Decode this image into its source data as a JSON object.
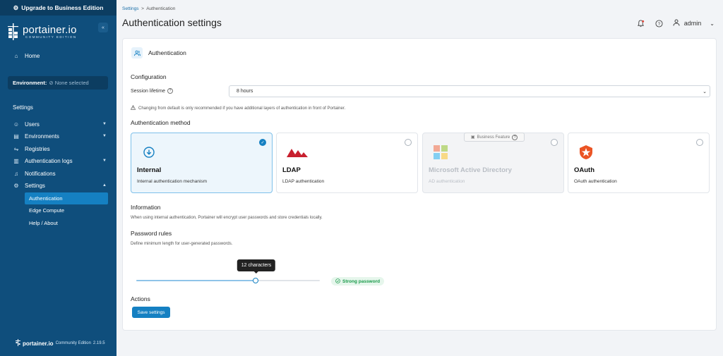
{
  "sidebar": {
    "upgrade_label": "Upgrade to Business Edition",
    "logo_name": "portainer.io",
    "logo_sub": "COMMUNITY EDITION",
    "home": "Home",
    "environment_label": "Environment:",
    "environment_value": "None selected",
    "section_settings": "Settings",
    "items": [
      {
        "label": "Users"
      },
      {
        "label": "Environments"
      },
      {
        "label": "Registries"
      },
      {
        "label": "Authentication logs"
      },
      {
        "label": "Notifications"
      },
      {
        "label": "Settings"
      }
    ],
    "sub_items": [
      {
        "label": "Authentication"
      },
      {
        "label": "Edge Compute"
      },
      {
        "label": "Help / About"
      }
    ],
    "footer_brand": "portainer.io",
    "footer_edition": "Community Edition",
    "footer_version": "2.19.5"
  },
  "header": {
    "breadcrumb_root": "Settings",
    "breadcrumb_sep": ">",
    "breadcrumb_current": "Authentication",
    "title": "Authentication settings",
    "user": "admin"
  },
  "card": {
    "title": "Authentication",
    "configuration": "Configuration",
    "session_label": "Session lifetime",
    "session_value": "8 hours",
    "session_warning": "Changing from default is only recommended if you have additional layers of authentication in front of Portainer.",
    "auth_method": "Authentication method",
    "methods": [
      {
        "name": "Internal",
        "desc": "Internal authentication mechanism"
      },
      {
        "name": "LDAP",
        "desc": "LDAP authentication"
      },
      {
        "name": "Microsoft Active Directory",
        "desc": "AD authentication",
        "badge": "Business Feature"
      },
      {
        "name": "OAuth",
        "desc": "OAuth authentication"
      }
    ],
    "information": "Information",
    "info_text": "When using internal authentication, Portainer will encrypt user passwords and store credentials locally.",
    "password_rules": "Password rules",
    "password_rules_desc": "Define minimum length for user-generated passwords.",
    "slider_tooltip": "12 characters",
    "slider_value_fraction": 0.65,
    "strength": "Strong password",
    "actions": "Actions",
    "save": "Save settings"
  },
  "colors": {
    "sidebar_bg": "#0f4e7c",
    "accent": "#1580c2",
    "success": "#1a9a4a"
  }
}
